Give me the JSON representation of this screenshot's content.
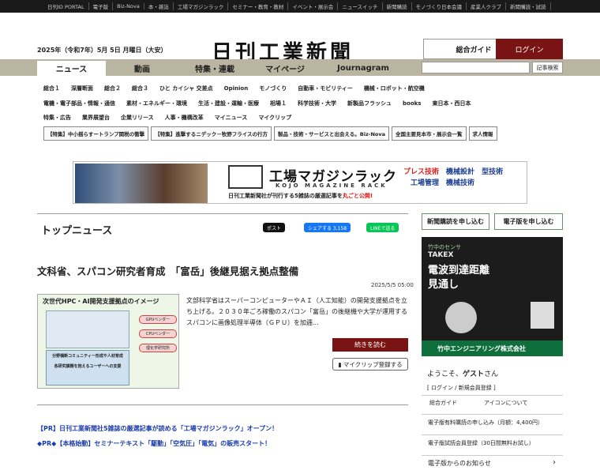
{
  "topbar": {
    "links": [
      "日刊ID PORTAL",
      "電子版",
      "Biz-Nova",
      "本・雑誌",
      "工場マガジンラック",
      "セミナー・教育・教材",
      "イベント・展示会",
      "ニュースイッチ",
      "新聞購読",
      "モノづくり日本会議",
      "産業人クラブ",
      "新聞購読・試読"
    ]
  },
  "header": {
    "date": "2025年（令和7年）5月 5日 月曜日（大安）",
    "logo": "日刊工業新聞",
    "guide_button": "総合ガイド",
    "login_button": "ログイン"
  },
  "nav": {
    "tabs": [
      "ニュース",
      "動画",
      "特集・連載",
      "マイページ",
      "Journagram"
    ],
    "search_placeholder": "",
    "search_button": "記事検索"
  },
  "categories": {
    "row1": [
      "総合１",
      "深層断面",
      "総合２",
      "総合３",
      "ひと カイシャ 交差点",
      "Opinion",
      "モノづくり",
      "自動車・モビリティー",
      "機械・ロボット・航空機"
    ],
    "row2": [
      "電機・電子部品・情報・通信",
      "素材・エネルギー・環境",
      "生活・建設・運輸・医療",
      "相場１",
      "科学技術・大学",
      "新製品フラッシュ",
      "books",
      "東日本・西日本"
    ],
    "row3": [
      "特集・広告",
      "業界展望台",
      "企業リリース",
      "人事・機構改革",
      "マイニュース",
      "マイクリップ"
    ]
  },
  "features": [
    "【特集】中小揺らすートランプ関税の衝撃",
    "【特集】進撃するニデック－牧野フライスの行方",
    "製品・技術・サービスと出会える。Biz-Nova",
    "全国主要見本市・展示会一覧",
    "求人情報"
  ],
  "banner": {
    "title": "工場マガジンラック",
    "subtitle": "KOJO MAGAZINE RACK",
    "desc_prefix": "日刊工業新聞社が刊行する5雑誌の厳選記事を",
    "desc_highlight": "丸ごと公開!",
    "mag_line1a": "プレス技術",
    "mag_line1b": "機械設計",
    "mag_line1c": "型技術",
    "mag_line2a": "工場管理",
    "mag_line2b": "機械技術"
  },
  "top_news": {
    "section_title": "トップニュース",
    "share_x": "ポスト",
    "share_fb": "シェアする 3,158",
    "share_line": "LINEで送る",
    "headline": "文科省、スパコン研究者育成　「富岳」後継見据え拠点整備",
    "timestamp": "2025/5/5 05:00",
    "figure_title": "次世代HPC・AI開発支援拠点のイメージ",
    "figure_pills": [
      "GPUベンダー",
      "CPUベンダー",
      "理化学研究所"
    ],
    "figure_box1": "分野横断コミュニティー形成や人材育成",
    "figure_box2": "各研究課題を抱えるユーザーへの支援",
    "summary": "文部科学省はスーパーコンピューターやＡＩ（人工知能）の開発支援拠点を立ち上げる。２０３０年ごろ稼働のスパコン「富岳」の後継機や大学が運用するスパコンに画像処理半導体（ＧＰＵ）を加逓...",
    "read_more": "続きを読む",
    "clip": "マイクリップ登録する"
  },
  "pr": [
    "【PR】日刊工業新聞社5雑誌の厳選記事が読める「工場マガジンラック」オープン！",
    "◆PR◆【本格始動】セミナーテキスト「駆動」「空気圧」「電気」の販売スタート！"
  ],
  "sidebar": {
    "subscribe": "新聞購読を申し込む",
    "digital": "電子版を申し込む",
    "ad_brand": "竹中のセンサ",
    "ad_takex": "TAKEX",
    "ad_copy1": "電波到達距離",
    "ad_copy2": "見通し",
    "ad_footer": "竹中エンジニアリング株式会社",
    "welcome_prefix": "ようこそ、",
    "welcome_name": "ゲスト",
    "welcome_suffix": "さん",
    "login_register": "[ ログイン / 新規会員登録 ]",
    "guide": "総合ガイド",
    "icons": "アイコンについて",
    "plan_paid": "電子版有料購読の申し込み（月額：4,400円）",
    "plan_trial": "電子版試読会員登録（30日間無料お試し）",
    "notice": "電子版からのお知らせ"
  },
  "colors": {
    "nav_bg": "#b9b5a0",
    "accent": "#7a1414",
    "pr_link": "#1a3ba8",
    "ad_green": "#0f6f3c"
  }
}
